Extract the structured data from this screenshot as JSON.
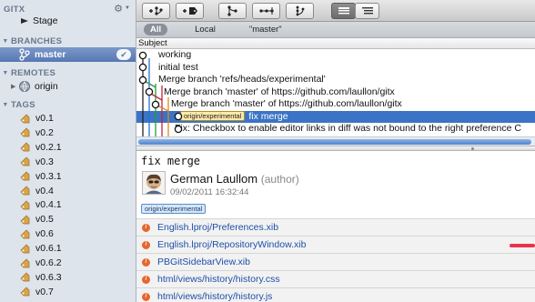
{
  "sidebar": {
    "gitx_header": "GITX",
    "stage_label": "Stage",
    "branches_header": "BRANCHES",
    "branch_selected": "master",
    "check_glyph": "✔",
    "remotes_header": "REMOTES",
    "remote_origin": "origin",
    "tags_header": "TAGS",
    "tags": [
      "v0.1",
      "v0.2",
      "v0.2.1",
      "v0.3",
      "v0.3.1",
      "v0.4",
      "v0.4.1",
      "v0.5",
      "v0.6",
      "v0.6.1",
      "v0.6.2",
      "v0.6.3",
      "v0.7"
    ],
    "icons": {
      "gear": "gear-icon",
      "tag": "tag-icon",
      "stage": "stage-icon",
      "branch": "branch-icon",
      "remote": "remote-icon"
    },
    "colors": {
      "tag": "#d8a34a",
      "selection": "#5678b3"
    }
  },
  "toolbar": {
    "buttons": [
      "add-branch-icon",
      "add-tag-icon",
      "merge-icon",
      "cherry-pick-icon",
      "rebase-icon",
      "history-view-icon",
      "commit-view-icon"
    ]
  },
  "scopebar": {
    "all": "All",
    "local": "Local",
    "master": "\"master\""
  },
  "commits": {
    "header": "Subject",
    "rows": [
      {
        "subject": "working",
        "ref": ""
      },
      {
        "subject": "initial test",
        "ref": ""
      },
      {
        "subject": "Merge branch 'refs/heads/experimental'",
        "ref": ""
      },
      {
        "subject": "Merge branch 'master' of https://github.com/laullon/gitx",
        "ref": ""
      },
      {
        "subject": "Merge branch 'master' of https://github.com/laullon/gitx",
        "ref": ""
      },
      {
        "subject": "fix merge",
        "ref": "origin/experimental"
      },
      {
        "subject": "Fix: Checkbox to enable editor links in diff was not bound to the right preference C",
        "ref": ""
      }
    ],
    "selected_index": 5,
    "colors": {
      "selected": "#3b74c6"
    }
  },
  "detail": {
    "subject": "fix merge",
    "author": "German Laullom",
    "role": "(author)",
    "date": "09/02/2011 16:32:44",
    "ref": "origin/experimental",
    "files": [
      "English.lproj/Preferences.xib",
      "English.lproj/RepositoryWindow.xib",
      "PBGitSidebarView.xib",
      "html/views/history/history.css",
      "html/views/history/history.js"
    ],
    "colors": {
      "file_icon": "#e4672f",
      "file_link": "#1f4fa8",
      "marker": "#e8344b"
    }
  }
}
